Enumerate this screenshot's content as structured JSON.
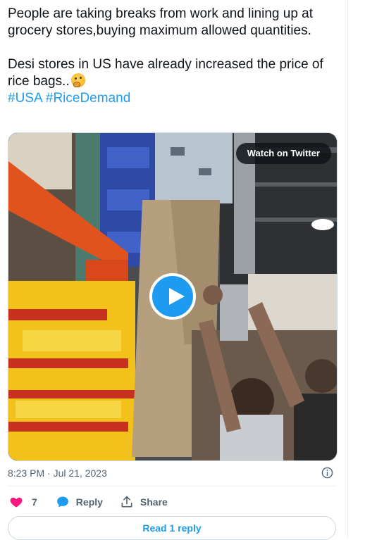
{
  "tweet": {
    "line1": "People are taking breaks from work and lining up at grocery stores,buying maximum allowed quantities.",
    "line2": "Desi stores in US have already increased the price of rice bags..",
    "emoji_icon": "thinking-face-emoji",
    "hashtags": [
      "#USA",
      "#RiceDemand"
    ]
  },
  "media": {
    "watch_label": "Watch on Twitter",
    "play_icon": "play-icon"
  },
  "meta": {
    "timestamp": "8:23 PM · Jul 21, 2023"
  },
  "actions": {
    "like_count": "7",
    "reply_label": "Reply",
    "share_label": "Share"
  },
  "read_reply_label": "Read 1 reply",
  "colors": {
    "accent": "#1d9bf0",
    "like": "#f91880",
    "text": "#0f1419",
    "muted": "#536471"
  }
}
